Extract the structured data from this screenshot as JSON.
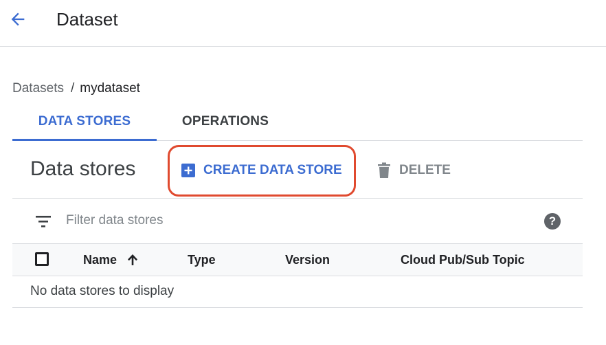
{
  "header": {
    "back_icon": "arrow-back-icon",
    "title": "Dataset"
  },
  "breadcrumb": {
    "parent": "Datasets",
    "separator": "/",
    "current": "mydataset"
  },
  "tabs": [
    {
      "label": "DATA STORES",
      "active": true
    },
    {
      "label": "OPERATIONS",
      "active": false
    }
  ],
  "toolbar": {
    "section_title": "Data stores",
    "create_label": "CREATE DATA STORE",
    "create_icon": "add-box-icon",
    "delete_label": "DELETE",
    "delete_icon": "trash-icon",
    "highlight_color": "#e04a2f"
  },
  "filter": {
    "icon": "filter-list-icon",
    "placeholder": "Filter data stores",
    "value": "",
    "help_icon": "help-icon",
    "help_glyph": "?"
  },
  "table": {
    "columns": [
      {
        "label": "Name",
        "sorted": "ascending"
      },
      {
        "label": "Type"
      },
      {
        "label": "Version"
      },
      {
        "label": "Cloud Pub/Sub Topic"
      }
    ],
    "rows": [],
    "empty_message": "No data stores to display"
  },
  "colors": {
    "accent": "#3c6cd1",
    "text": "#202124",
    "muted": "#80868b",
    "divider": "#dadce0"
  }
}
